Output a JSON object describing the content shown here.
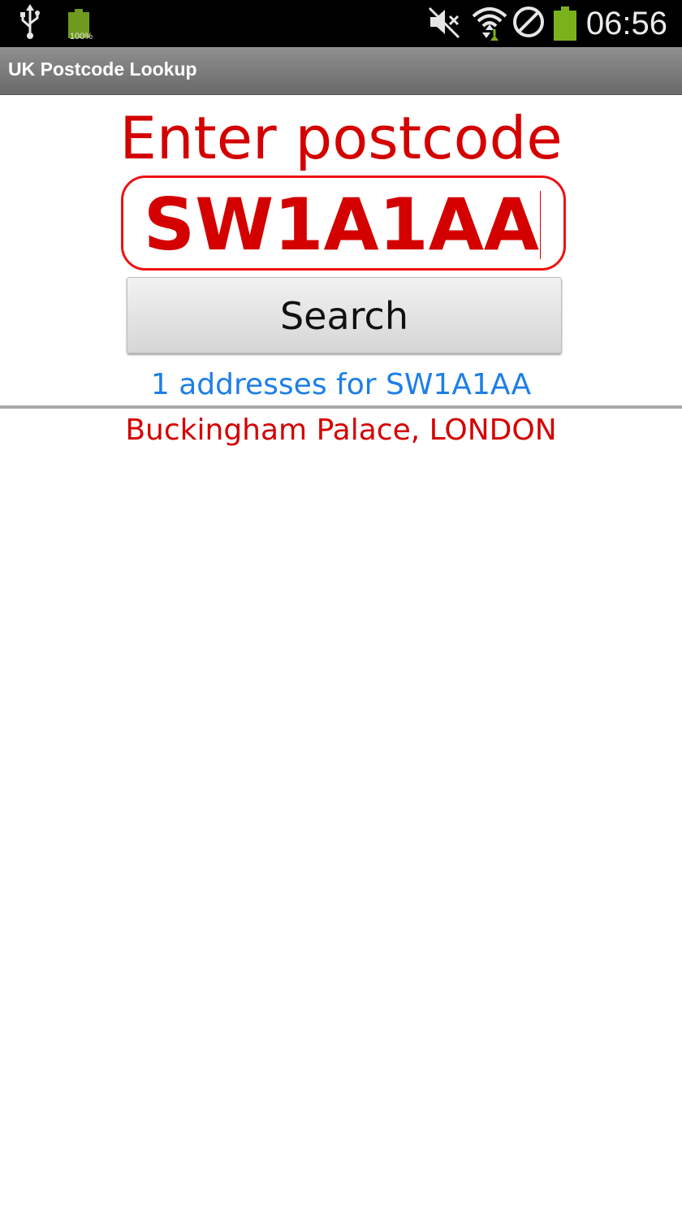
{
  "status_bar": {
    "time": "06:56",
    "notification_battery_percent": "100%",
    "icons": [
      "usb-icon",
      "battery-icon",
      "mute-icon",
      "wifi-icon",
      "no-sync-icon",
      "battery-icon"
    ]
  },
  "action_bar": {
    "title": "UK Postcode Lookup"
  },
  "form": {
    "prompt": "Enter postcode",
    "postcode_value": "SW1A1AA",
    "search_label": "Search"
  },
  "results": {
    "summary": "1 addresses for SW1A1AA",
    "addresses": [
      "Buckingham Palace, LONDON"
    ]
  },
  "colors": {
    "accent_red": "#d40000",
    "link_blue": "#1e7fe6",
    "battery_green": "#7bb21c"
  }
}
